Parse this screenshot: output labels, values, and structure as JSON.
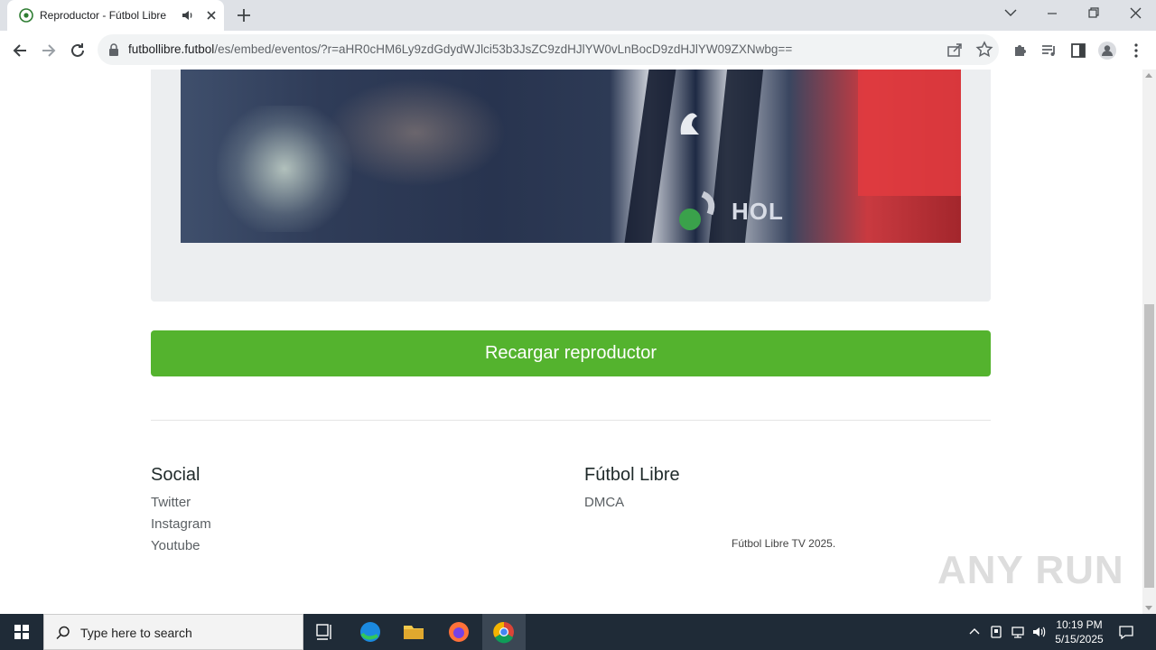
{
  "browser": {
    "tab_title": "Reproductor - Fútbol Libre TV",
    "url_host": "futbollibre.futbol",
    "url_path": "/es/embed/eventos/?r=aHR0cHM6Ly9zdGdydWJlci53b3JsZC9zdHJlYW0vLnBocD9zdHJlYW09ZXNwbg=="
  },
  "page": {
    "video_overlay_text": "HOL",
    "reload_button": "Recargar reproductor",
    "footer": {
      "social_title": "Social",
      "social_links": [
        "Twitter",
        "Instagram",
        "Youtube"
      ],
      "brand_title": "Fútbol Libre",
      "brand_links": [
        "DMCA"
      ],
      "copyright": "Fútbol Libre TV 2025."
    }
  },
  "watermark": "ANY RUN",
  "taskbar": {
    "search_placeholder": "Type here to search",
    "time": "10:19 PM",
    "date": "5/15/2025"
  },
  "colors": {
    "accent_green": "#54b32e",
    "taskbar": "#1f2b37"
  }
}
